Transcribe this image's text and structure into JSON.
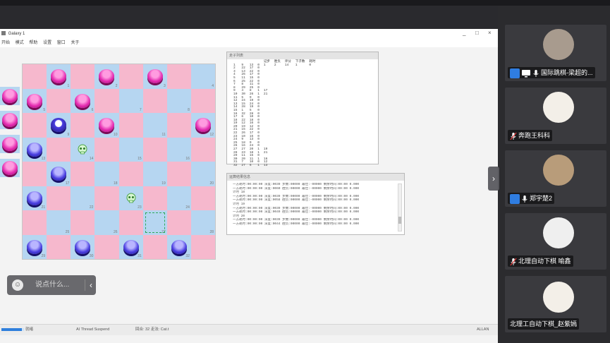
{
  "window": {
    "title": "Galaxy 1",
    "menu": [
      "开始",
      "模式",
      "帮助",
      "设置",
      "窗口",
      "关于"
    ],
    "controls": [
      "_",
      "□",
      "×"
    ]
  },
  "board": {
    "square_numbers": [
      "1",
      "2",
      "3",
      "4",
      "5",
      "6",
      "7",
      "8",
      "9",
      "10",
      "11",
      "12",
      "13",
      "14",
      "15",
      "16",
      "17",
      "18",
      "19",
      "20",
      "21",
      "22",
      "23",
      "24",
      "25",
      "26",
      "27",
      "28",
      "29",
      "30",
      "31",
      "32"
    ],
    "colors": {
      "light": "#f6b8cd",
      "dark": "#b6d6f1",
      "pink_piece": "#e42bb0",
      "blue_piece": "#4a3ee0"
    }
  },
  "move_panel": {
    "title": "走子列表",
    "headers": [
      "",
      "",
      "",
      "",
      "记步",
      "胜负",
      "评分",
      "下子数",
      "耗时"
    ],
    "rows": [
      [
        "1",
        "9",
        "13",
        "0",
        "1",
        "2",
        "14",
        "1",
        "0"
      ],
      [
        "2",
        "22",
        "17",
        "0",
        "",
        "",
        "",
        "",
        ""
      ],
      [
        "3",
        "13",
        "22",
        "0",
        "",
        "",
        "",
        "",
        ""
      ],
      [
        "4",
        "26",
        "17",
        "0",
        "",
        "",
        "",
        "",
        ""
      ],
      [
        "5",
        "11",
        "15",
        "0",
        "",
        "",
        "",
        "",
        ""
      ],
      [
        "6",
        "25",
        "22",
        "0",
        "",
        "",
        "",
        "",
        ""
      ],
      [
        "7",
        "8",
        "11",
        "0",
        "",
        "",
        "",
        "",
        ""
      ],
      [
        "8",
        "29",
        "25",
        "0",
        "",
        "",
        "",
        "",
        ""
      ],
      [
        "9",
        "4",
        "8",
        "1",
        "17",
        "",
        "",
        "",
        ""
      ],
      [
        "10",
        "30",
        "26",
        "1",
        "21",
        "",
        "",
        "",
        ""
      ],
      [
        "11",
        "5",
        "9",
        "0",
        "",
        "",
        "",
        "",
        ""
      ],
      [
        "12",
        "24",
        "19",
        "0",
        "",
        "",
        "",
        "",
        ""
      ],
      [
        "13",
        "15",
        "24",
        "0",
        "",
        "",
        "",
        "",
        ""
      ],
      [
        "14",
        "28",
        "19",
        "0",
        "",
        "",
        "",
        "",
        ""
      ],
      [
        "15",
        "1",
        "5",
        "0",
        "",
        "",
        "",
        "",
        ""
      ],
      [
        "16",
        "32",
        "28",
        "0",
        "",
        "",
        "",
        "",
        ""
      ],
      [
        "17",
        "6",
        "10",
        "0",
        "",
        "",
        "",
        "",
        ""
      ],
      [
        "18",
        "22",
        "18",
        "0",
        "",
        "",
        "",
        "",
        ""
      ],
      [
        "19",
        "12",
        "16",
        "0",
        "",
        "",
        "",
        "",
        ""
      ],
      [
        "20",
        "19",
        "12",
        "0",
        "",
        "",
        "",
        "",
        ""
      ],
      [
        "21",
        "15",
        "22",
        "0",
        "",
        "",
        "",
        "",
        ""
      ],
      [
        "22",
        "26",
        "17",
        "0",
        "",
        "",
        "",
        "",
        ""
      ],
      [
        "23",
        "10",
        "15",
        "0",
        "",
        "",
        "",
        "",
        ""
      ],
      [
        "24",
        "9",
        "13",
        "0",
        "",
        "",
        "",
        "",
        ""
      ],
      [
        "25",
        "18",
        "9",
        "0",
        "",
        "",
        "",
        "",
        ""
      ],
      [
        "26",
        "16",
        "24",
        "0",
        "",
        "",
        "",
        "",
        ""
      ],
      [
        "27",
        "27",
        "20",
        "1",
        "19",
        "",
        "",
        "",
        ""
      ],
      [
        "28",
        "23",
        "18",
        "1",
        "21",
        "",
        "",
        "",
        ""
      ],
      [
        "29",
        "11",
        "15",
        "0",
        "",
        "",
        "",
        "",
        ""
      ],
      [
        "30",
        "20",
        "11",
        "1",
        "16",
        "",
        "",
        "",
        ""
      ],
      [
        "31",
        "7",
        "10",
        "0",
        "12",
        "",
        "",
        "",
        ""
      ],
      [
        "32",
        "27",
        "6",
        "1",
        "13",
        "",
        "",
        "",
        ""
      ]
    ]
  },
  "log_panel": {
    "title": "运算结果信息",
    "lines": [
      "一方耗时:00:00:00  深度:0039  步数:00000  最佳:-00000  剩余时间:00:00 0.000",
      "一方耗时:00:00:00  深度:0060  胜负:00000  最佳:-00000  剩余时间:00:00 0.000",
      "计时  18",
      "一方耗时:00:00:00  深度:0039  步数:00000  最佳:-00000  剩余时间:00:00 0.000",
      "一方耗时:00:00:00  深度:0058  胜负:00000  最佳:-00000  剩余时间:00:00 0.000",
      "计时  19",
      "一方耗时:00:00:00  深度:0039  步数:00000  最佳:-00000  剩余时间:00:00 0.000",
      "一方耗时:00:00:00  深度:0049  胜负:00000  最佳:-00000  剩余时间:00:00 0.000",
      "计时  20",
      "一方耗时:00:00:00  深度:0039  步数:00000  最佳:-00000  剩余时间:00:00 0.000",
      "一方耗时:00:00:00  深度:0044  胜负:00000  最佳:-00000  剩余时间:00:00 0.000"
    ]
  },
  "status": {
    "left": "就绪",
    "thread": "AI Thread Suspend",
    "info": "回合: 32  走法: Cat.t",
    "right": "ALLAN",
    "progress": 0.9
  },
  "chat": {
    "placeholder": "说点什么...",
    "emoji": "☺",
    "collapse": "‹"
  },
  "sidebar": {
    "expand": "›",
    "participants": [
      {
        "name": "国际跳棋-梁超的...",
        "host": true,
        "sharing": true,
        "mic": "on"
      },
      {
        "name": "奔跑王科科",
        "host": false,
        "sharing": false,
        "mic": "muted"
      },
      {
        "name": "郑宇楚2",
        "host": true,
        "sharing": false,
        "mic": "on"
      },
      {
        "name": "北理自动下棋 喻鑫",
        "host": false,
        "sharing": false,
        "mic": "muted"
      },
      {
        "name": "北理工自动下棋_赵紫嫣",
        "host": false,
        "sharing": false,
        "mic": "none"
      }
    ]
  }
}
